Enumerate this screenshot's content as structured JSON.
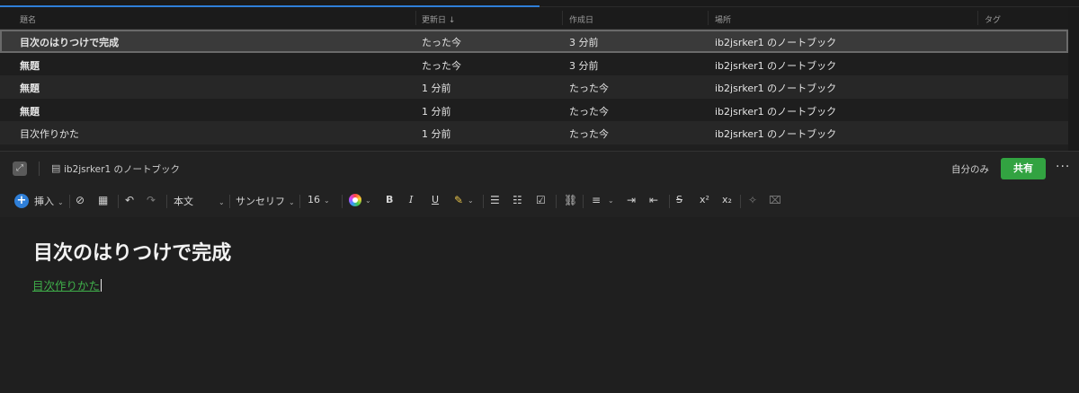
{
  "topbar": {
    "progress_percent": 50
  },
  "table": {
    "headers": {
      "title": "題名",
      "updated": "更新日 ↓",
      "created": "作成日",
      "location": "場所",
      "tags": "タグ"
    },
    "rows": [
      {
        "title": "目次のはりつけで完成",
        "updated": "たった今",
        "created": "3 分前",
        "location": "ib2jsrker1 のノートブック"
      },
      {
        "title": "無題",
        "updated": "たった今",
        "created": "3 分前",
        "location": "ib2jsrker1 のノートブック"
      },
      {
        "title": "無題",
        "updated": "1 分前",
        "created": "たった今",
        "location": "ib2jsrker1 のノートブック"
      },
      {
        "title": "無題",
        "updated": "1 分前",
        "created": "たった今",
        "location": "ib2jsrker1 のノートブック"
      },
      {
        "title": "目次作りかた",
        "updated": "1 分前",
        "created": "たった今",
        "location": "ib2jsrker1 のノートブック"
      }
    ]
  },
  "note_header": {
    "notebook": "ib2jsrker1 のノートブック",
    "visibility": "自分のみ",
    "share_label": "共有",
    "more_label": "···"
  },
  "toolbar": {
    "insert_label": "挿入",
    "style_label": "本文",
    "font_label": "サンセリフ",
    "size_label": "16",
    "bold": "B",
    "italic": "I",
    "underline": "U",
    "superscript": "x²",
    "subscript": "x₂"
  },
  "editor": {
    "title": "目次のはりつけで完成",
    "link_text": "目次作りかた"
  },
  "colors": {
    "accent_blue": "#2f7fd8",
    "share_green": "#32a341",
    "link_green": "#3fae4a"
  }
}
